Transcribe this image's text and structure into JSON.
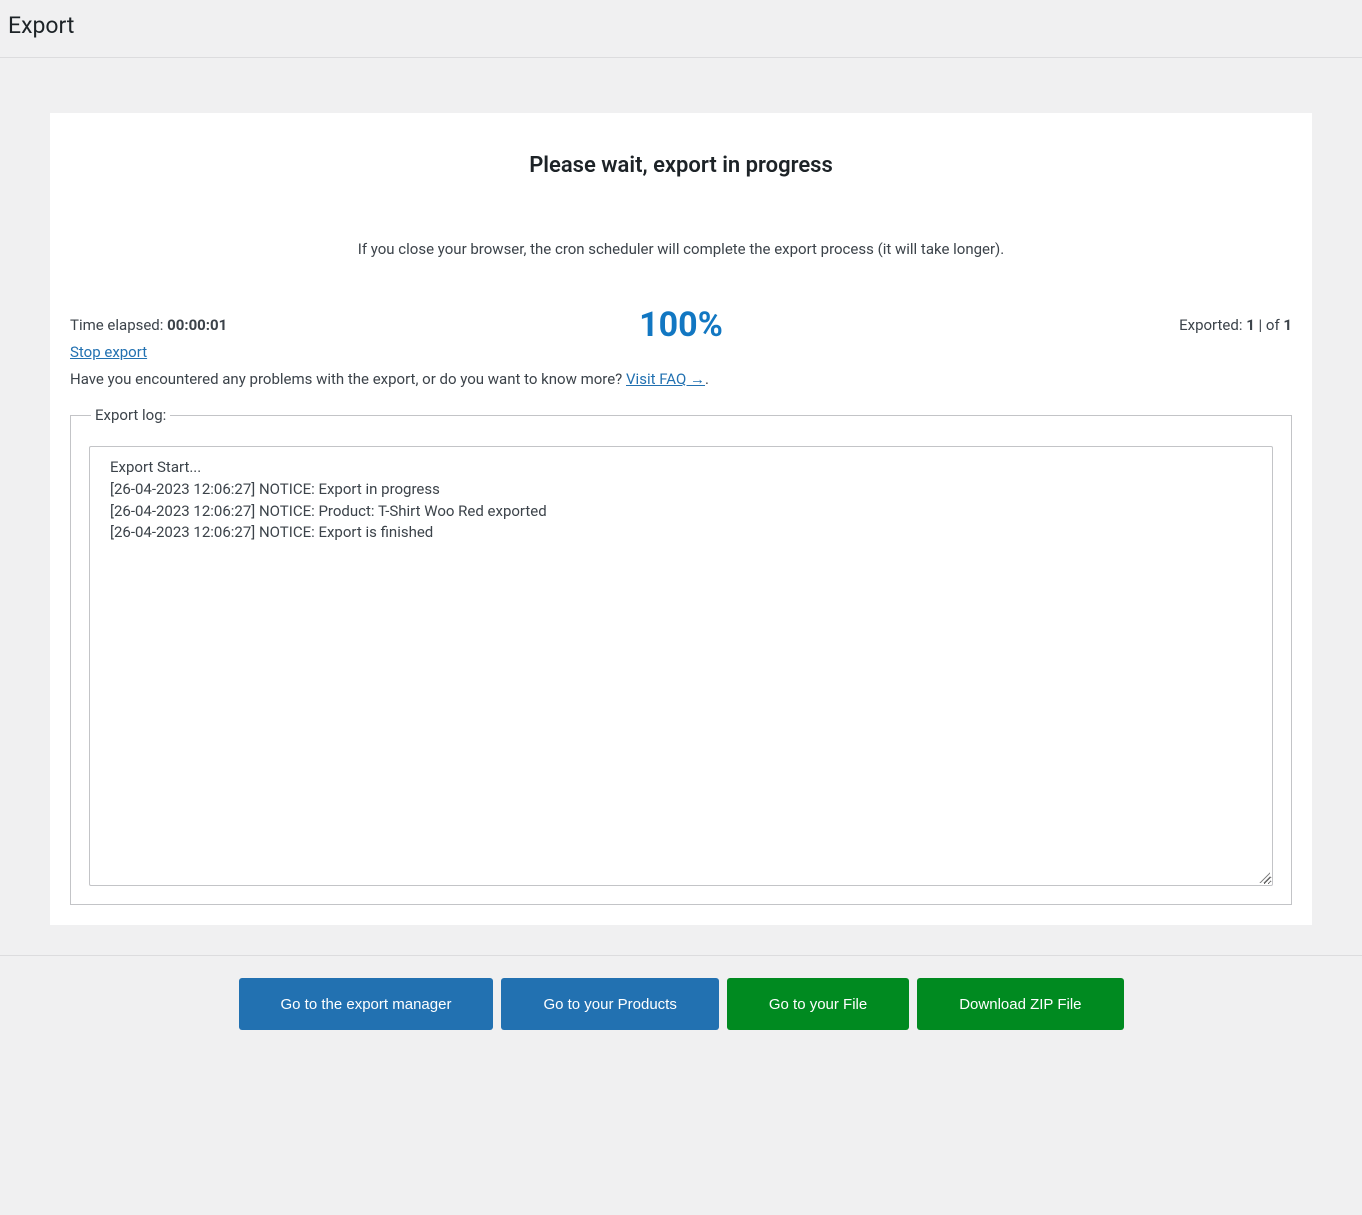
{
  "page": {
    "title": "Export"
  },
  "card": {
    "title": "Please wait, export in progress",
    "subtitle": "If you close your browser, the cron scheduler will complete the export process (it will take longer)."
  },
  "status": {
    "elapsed_label": "Time elapsed: ",
    "elapsed_value": "00:00:01",
    "percent": "100%",
    "exported_label": "Exported: ",
    "exported_count": "1",
    "exported_sep": " | of ",
    "exported_total": "1"
  },
  "links": {
    "stop": "Stop export",
    "faq_text": "Have you encountered any problems with the export, or do you want to know more? ",
    "faq_link": "Visit FAQ →",
    "faq_dot": "."
  },
  "log": {
    "legend": "Export log:",
    "content": "Export Start...\n[26-04-2023 12:06:27] NOTICE: Export in progress\n[26-04-2023 12:06:27] NOTICE: Product: T-Shirt Woo Red exported\n[26-04-2023 12:06:27] NOTICE: Export is finished"
  },
  "buttons": {
    "export_manager": "Go to the export manager",
    "products": "Go to your Products",
    "file": "Go to your File",
    "zip": "Download ZIP File"
  }
}
